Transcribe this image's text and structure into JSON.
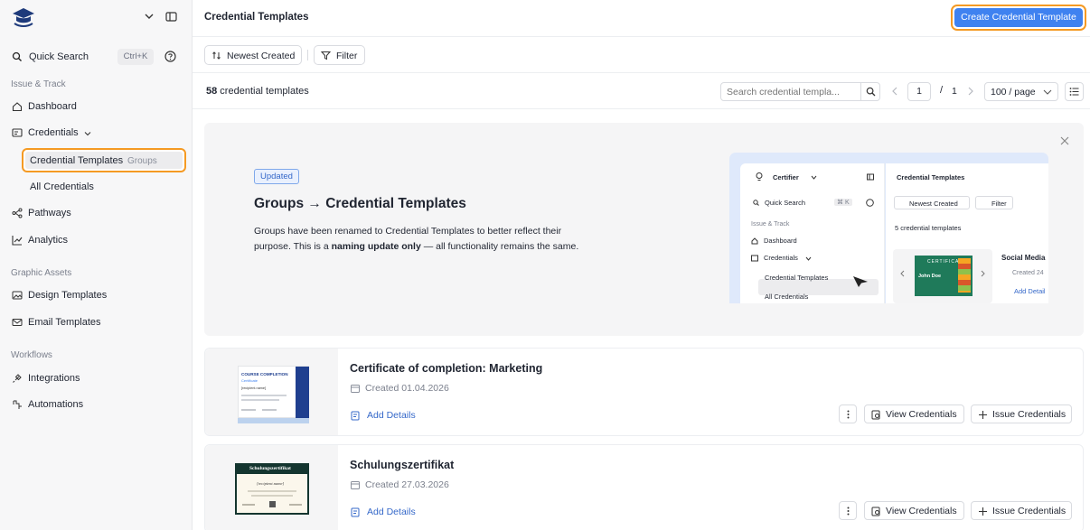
{
  "sidebar": {
    "logo": "institution-logo",
    "quick_search": {
      "label": "Quick Search",
      "shortcut": "Ctrl+K"
    },
    "sections": [
      "Issue & Track",
      "Graphic Assets",
      "Workflows"
    ],
    "items": {
      "dashboard": "Dashboard",
      "credentials": "Credentials",
      "credential_templates": "Credential Templates",
      "credential_templates_tag": "Groups",
      "all_credentials": "All Credentials",
      "pathways": "Pathways",
      "analytics": "Analytics",
      "design_templates": "Design Templates",
      "email_templates": "Email Templates",
      "integrations": "Integrations",
      "automations": "Automations"
    }
  },
  "header": {
    "title": "Credential Templates",
    "create_button": "Create Credential Template"
  },
  "toolbar": {
    "sort_label": "Newest Created",
    "filter_label": "Filter"
  },
  "listbar": {
    "count_number": "58",
    "count_text": " credential templates",
    "search_placeholder": "Search credential templa...",
    "page_current": "1",
    "page_sep": "/",
    "page_total": "1",
    "page_size": "100 / page"
  },
  "banner": {
    "badge": "Updated",
    "title": "Groups → Credential Templates",
    "text_1": "Groups have been renamed to Credential Templates to better reflect their purpose. This is a ",
    "text_bold": "naming update only",
    "text_2": " — all functionality remains the same.",
    "preview": {
      "brand": "Certifier",
      "quick_search": "Quick Search",
      "shortcut": "⌘ K",
      "section": "Issue & Track",
      "dashboard": "Dashboard",
      "credentials": "Credentials",
      "credential_templates": "Credential Templates",
      "all_credentials": "All Credentials",
      "title": "Credential Templates",
      "sort": "Newest Created",
      "filter": "Filter",
      "count": "5 credential templates",
      "card_title": "Social Media",
      "card_date": "Created 24",
      "card_add": "Add Detail",
      "cert_name": "John Doe"
    }
  },
  "cards": [
    {
      "title": "Certificate of completion: Marketing",
      "date": "Created 01.04.2026",
      "add_details": "Add Details",
      "view_label": "View Credentials",
      "issue_label": "Issue Credentials",
      "thumb_heading": "COURSE COMPLETION",
      "thumb_sub": "Certificate",
      "thumb_name": "[recipient.name]"
    },
    {
      "title": "Schulungszertifikat",
      "date": "Created 27.03.2026",
      "add_details": "Add Details",
      "view_label": "View Credentials",
      "issue_label": "Issue Credentials",
      "thumb_heading": "Schulungszertifikat",
      "thumb_name": "[recipient.name]"
    }
  ],
  "colors": {
    "accent": "#3f82f0",
    "highlight": "#f59a23",
    "link": "#3568c9"
  }
}
